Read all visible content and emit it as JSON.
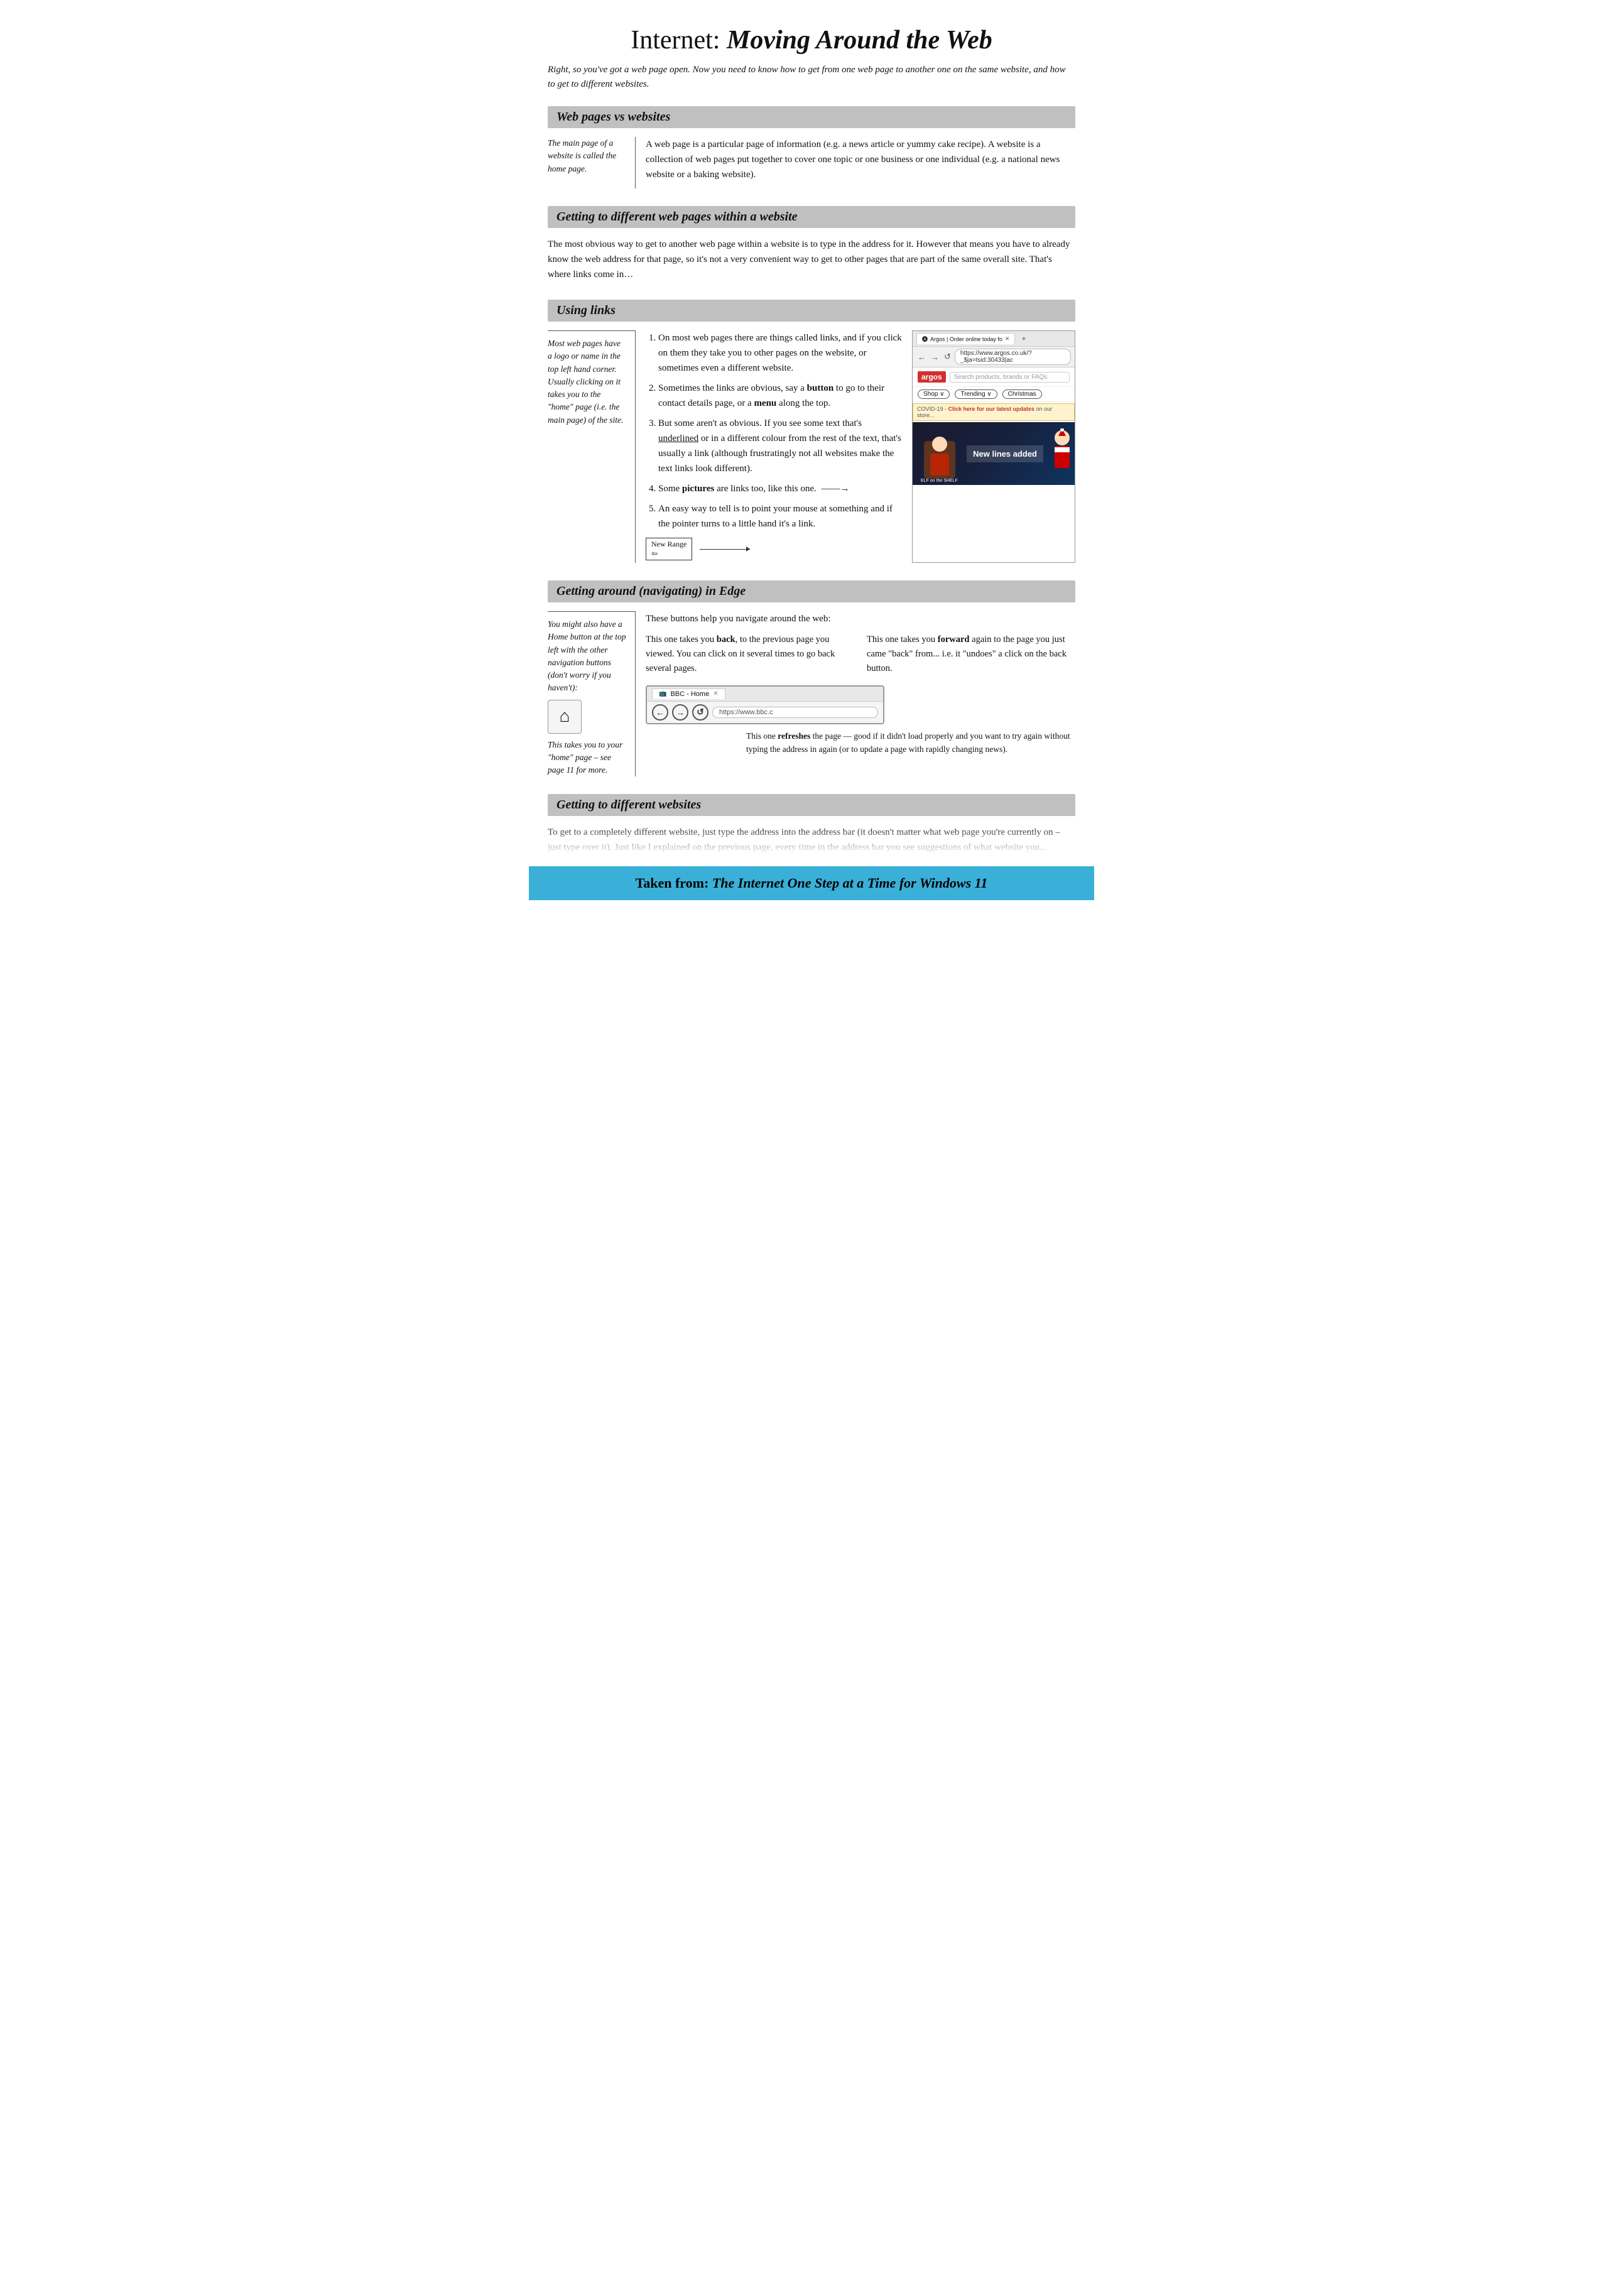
{
  "page": {
    "title_prefix": "Internet: ",
    "title_em": "Moving Around the Web",
    "subtitle": "Right, so you've got a web page open.  Now you need to know how to get from one web page to another one on the same website, and how to get to different websites.",
    "sections": {
      "webpages_vs_websites": {
        "heading": "Web pages vs websites",
        "sidebar_note": "The main page of a website is called the home page.",
        "body": "A web page is a particular page of information (e.g. a news article or yummy cake recipe). A website is a collection of web pages put together to cover one topic or one business or one individual (e.g. a national news website or a baking website)."
      },
      "getting_different_pages": {
        "heading": "Getting to different web pages within a website",
        "body": "The most obvious way to get to another web page within a website is to type in the address for it.  However that means you have to already know the web address for that page, so it's not a very convenient way to get to other pages that are part of the same overall site.  That's where links come in…"
      },
      "using_links": {
        "heading": "Using links",
        "sidebar_note": "Most web pages have a logo or name in the top left hand corner. Usually clicking on it takes you to the \"home\" page (i.e. the main page) of the site.",
        "items": [
          "On most web pages there are things called links, and if you click on them they take you to other pages on the website, or sometimes even a different website.",
          "Sometimes the links are obvious, say a button to go to their contact details page, or a menu along the top.",
          "But some aren't as obvious.  If you see some text that's underlined or in a different colour from the rest of the text, that's usually a link (although frustratingly not all websites make the text links look different).",
          "Some pictures are links too, like this one.",
          "An easy way to tell is to point your mouse at something and if the pointer turns to a little hand it's a link."
        ],
        "item2_bold1": "button",
        "item2_bold2": "menu",
        "item3_underline": "underlined",
        "item4_bold": "pictures",
        "new_range_label": "New Range",
        "browser_tab_label": "Argos | Order online today fo",
        "address_bar_text": "https://www.argos.co.uk/?_$ja=tsid:30433|ac",
        "argos_search_placeholder": "Search products, brands or FAQs",
        "argos_nav_items": [
          "Shop ∨",
          "Trending ∨",
          "Christmas"
        ],
        "covid_text": "COVID-19 - Click here for our latest updates on our store",
        "new_lines_text": "New lines added"
      },
      "navigating_edge": {
        "heading": "Getting around (navigating) in Edge",
        "intro": "These buttons help you navigate around the web:",
        "sidebar_note": "You might also have a Home button at the top left with the other navigation buttons (don't worry if you haven't):",
        "sidebar_note2": "This takes you to your \"home\" page – see page 11 for more.",
        "back_text": "This one takes you back, to the previous page you viewed.  You can click on it several times to go back several pages.",
        "forward_text": "This one takes you forward again to the page you just came \"back\" from... i.e. it \"undoes\" a click on the back button.",
        "refresh_text": "This one refreshes the page — good if it didn't load properly and you want to try again without typing the address in again (or to update a page with rapidly changing news).",
        "back_bold": "back",
        "forward_bold": "forward",
        "refresh_bold": "refreshes",
        "browser_tab_text": "BBC - Home",
        "browser_address": "https://www.bbc.c",
        "home_button_unicode": "⌂"
      },
      "getting_different_websites": {
        "heading": "Getting to different websites",
        "body": "To get to a completely different website, just type the address into the address bar (it doesn't matter what web page you're currently on – just type over it).  Just like I explained on the previous page, every time in the address bar you see suggestions of what website you..."
      }
    },
    "footer": {
      "prefix": "Taken from: ",
      "em_text": "The Internet One Step at a Time for Windows 11"
    }
  }
}
